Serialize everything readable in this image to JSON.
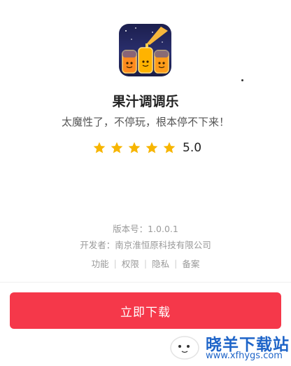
{
  "app": {
    "name": "果汁调调乐",
    "tagline": "太魔性了，不停玩，根本停不下来！",
    "rating": 5.0,
    "rating_text": "5.0",
    "stars": 5,
    "icon": "juice-jars-app-icon",
    "version_label": "版本号：1.0.0.1",
    "developer_label": "开发者：南京淮恒原科技有限公司"
  },
  "links": [
    {
      "label": "功能"
    },
    {
      "label": "权限"
    },
    {
      "label": "隐私"
    },
    {
      "label": "备案"
    }
  ],
  "download": {
    "label": "立即下载"
  },
  "watermark": {
    "brand": "晓羊下载站",
    "url": "www.xfhygs.com"
  },
  "colors": {
    "accent": "#f5384a",
    "star": "#f7b500",
    "title": "#222222",
    "muted": "#9a9a9a",
    "watermark": "#1e64c8"
  }
}
